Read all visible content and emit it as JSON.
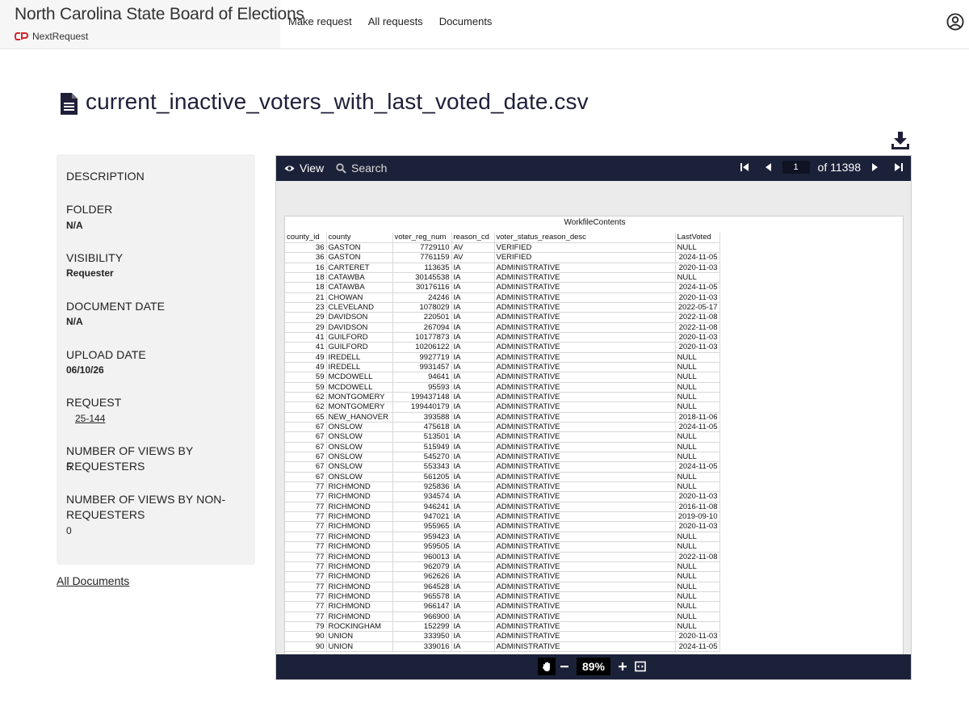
{
  "header": {
    "org_title": "North Carolina State Board of Elections",
    "brand_name": "NextRequest",
    "nav": [
      "Make request",
      "All requests",
      "Documents"
    ]
  },
  "document": {
    "title": "current_inactive_voters_with_last_voted_date.csv"
  },
  "sidebar": {
    "description_label": "DESCRIPTION",
    "folder_label": "FOLDER",
    "folder_value": "N/A",
    "visibility_label": "VISIBILITY",
    "visibility_value": "Requester",
    "document_date_label": "DOCUMENT DATE",
    "document_date_value": "N/A",
    "upload_date_label": "UPLOAD DATE",
    "upload_date_value": "06/10/26",
    "request_label": "REQUEST",
    "request_value": "25-144",
    "views_requesters_label": "NUMBER OF VIEWS BY REQUESTERS",
    "views_requesters_value": "5",
    "views_nonrequesters_label": "NUMBER OF VIEWS BY NON-REQUESTERS",
    "views_nonrequesters_value": "0",
    "all_documents_link": "All Documents"
  },
  "viewer": {
    "view_label": "View",
    "search_label": "Search",
    "page_current": "1",
    "page_total_label": "of 11398",
    "zoom": "89%",
    "sheet_title": "WorkfileContents",
    "columns": [
      "county_id",
      "county",
      "voter_reg_num",
      "reason_cd",
      "voter_status_reason_desc",
      "LastVoted"
    ],
    "rows": [
      [
        "36",
        "GASTON",
        "7729110",
        "AV",
        "VERIFIED",
        "NULL"
      ],
      [
        "36",
        "GASTON",
        "7761159",
        "AV",
        "VERIFIED",
        "2024-11-05"
      ],
      [
        "16",
        "CARTERET",
        "113635",
        "IA",
        "ADMINISTRATIVE",
        "2020-11-03"
      ],
      [
        "18",
        "CATAWBA",
        "30145538",
        "IA",
        "ADMINISTRATIVE",
        "NULL"
      ],
      [
        "18",
        "CATAWBA",
        "30176116",
        "IA",
        "ADMINISTRATIVE",
        "2024-11-05"
      ],
      [
        "21",
        "CHOWAN",
        "24246",
        "IA",
        "ADMINISTRATIVE",
        "2020-11-03"
      ],
      [
        "23",
        "CLEVELAND",
        "1078029",
        "IA",
        "ADMINISTRATIVE",
        "2022-05-17"
      ],
      [
        "29",
        "DAVIDSON",
        "220501",
        "IA",
        "ADMINISTRATIVE",
        "2022-11-08"
      ],
      [
        "29",
        "DAVIDSON",
        "267094",
        "IA",
        "ADMINISTRATIVE",
        "2022-11-08"
      ],
      [
        "41",
        "GUILFORD",
        "10177873",
        "IA",
        "ADMINISTRATIVE",
        "2020-11-03"
      ],
      [
        "41",
        "GUILFORD",
        "10206122",
        "IA",
        "ADMINISTRATIVE",
        "2020-11-03"
      ],
      [
        "49",
        "IREDELL",
        "9927719",
        "IA",
        "ADMINISTRATIVE",
        "NULL"
      ],
      [
        "49",
        "IREDELL",
        "9931457",
        "IA",
        "ADMINISTRATIVE",
        "NULL"
      ],
      [
        "59",
        "MCDOWELL",
        "94641",
        "IA",
        "ADMINISTRATIVE",
        "NULL"
      ],
      [
        "59",
        "MCDOWELL",
        "95593",
        "IA",
        "ADMINISTRATIVE",
        "NULL"
      ],
      [
        "62",
        "MONTGOMERY",
        "199437148",
        "IA",
        "ADMINISTRATIVE",
        "NULL"
      ],
      [
        "62",
        "MONTGOMERY",
        "199440179",
        "IA",
        "ADMINISTRATIVE",
        "NULL"
      ],
      [
        "65",
        "NEW_HANOVER",
        "393588",
        "IA",
        "ADMINISTRATIVE",
        "2018-11-06"
      ],
      [
        "67",
        "ONSLOW",
        "475618",
        "IA",
        "ADMINISTRATIVE",
        "2024-11-05"
      ],
      [
        "67",
        "ONSLOW",
        "513501",
        "IA",
        "ADMINISTRATIVE",
        "NULL"
      ],
      [
        "67",
        "ONSLOW",
        "515949",
        "IA",
        "ADMINISTRATIVE",
        "NULL"
      ],
      [
        "67",
        "ONSLOW",
        "545270",
        "IA",
        "ADMINISTRATIVE",
        "NULL"
      ],
      [
        "67",
        "ONSLOW",
        "553343",
        "IA",
        "ADMINISTRATIVE",
        "2024-11-05"
      ],
      [
        "67",
        "ONSLOW",
        "561205",
        "IA",
        "ADMINISTRATIVE",
        "NULL"
      ],
      [
        "77",
        "RICHMOND",
        "925836",
        "IA",
        "ADMINISTRATIVE",
        "NULL"
      ],
      [
        "77",
        "RICHMOND",
        "934574",
        "IA",
        "ADMINISTRATIVE",
        "2020-11-03"
      ],
      [
        "77",
        "RICHMOND",
        "946241",
        "IA",
        "ADMINISTRATIVE",
        "2016-11-08"
      ],
      [
        "77",
        "RICHMOND",
        "947021",
        "IA",
        "ADMINISTRATIVE",
        "2019-09-10"
      ],
      [
        "77",
        "RICHMOND",
        "955965",
        "IA",
        "ADMINISTRATIVE",
        "2020-11-03"
      ],
      [
        "77",
        "RICHMOND",
        "959423",
        "IA",
        "ADMINISTRATIVE",
        "NULL"
      ],
      [
        "77",
        "RICHMOND",
        "959505",
        "IA",
        "ADMINISTRATIVE",
        "NULL"
      ],
      [
        "77",
        "RICHMOND",
        "960013",
        "IA",
        "ADMINISTRATIVE",
        "2022-11-08"
      ],
      [
        "77",
        "RICHMOND",
        "962079",
        "IA",
        "ADMINISTRATIVE",
        "NULL"
      ],
      [
        "77",
        "RICHMOND",
        "962626",
        "IA",
        "ADMINISTRATIVE",
        "NULL"
      ],
      [
        "77",
        "RICHMOND",
        "964528",
        "IA",
        "ADMINISTRATIVE",
        "NULL"
      ],
      [
        "77",
        "RICHMOND",
        "965578",
        "IA",
        "ADMINISTRATIVE",
        "NULL"
      ],
      [
        "77",
        "RICHMOND",
        "966147",
        "IA",
        "ADMINISTRATIVE",
        "NULL"
      ],
      [
        "77",
        "RICHMOND",
        "966900",
        "IA",
        "ADMINISTRATIVE",
        "NULL"
      ],
      [
        "79",
        "ROCKINGHAM",
        "152299",
        "IA",
        "ADMINISTRATIVE",
        "NULL"
      ],
      [
        "90",
        "UNION",
        "333950",
        "IA",
        "ADMINISTRATIVE",
        "2020-11-03"
      ],
      [
        "90",
        "UNION",
        "339016",
        "IA",
        "ADMINISTRATIVE",
        "2024-11-05"
      ]
    ]
  },
  "colors": {
    "toolbar_bg": "#1b2138",
    "brand_red": "#d0262d",
    "title_color": "#1f1f3a",
    "sidebar_bg": "#f2f2f2"
  },
  "icons": {
    "file": "file-icon",
    "download": "download-icon",
    "user": "user-circle-icon",
    "view": "eye-icon",
    "search": "search-icon",
    "first_page": "first-page-icon",
    "prev_page": "prev-page-icon",
    "next_page": "next-page-icon",
    "last_page": "last-page-icon",
    "pan": "hand-icon",
    "zoom_out": "minus-icon",
    "zoom_in": "plus-icon",
    "fit": "fit-page-icon"
  }
}
